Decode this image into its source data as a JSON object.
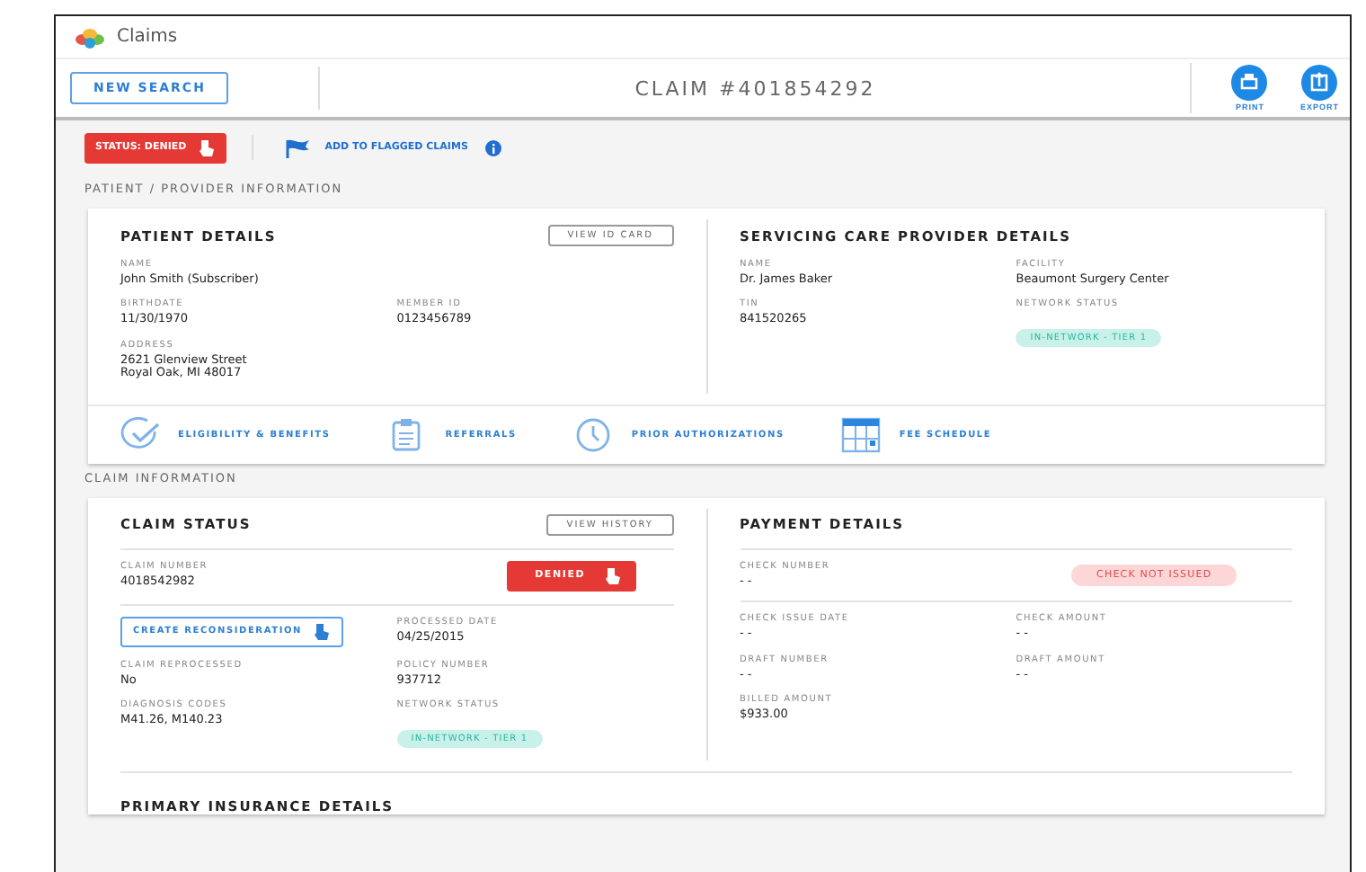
{
  "app": {
    "title": "Claims"
  },
  "toolbar": {
    "new_search": "NEW SEARCH",
    "claim_title": "CLAIM #401854292",
    "actions": [
      {
        "label": "PRINT",
        "kind": "print"
      },
      {
        "label": "EXPORT",
        "kind": "export"
      }
    ]
  },
  "status_row": {
    "status": "STATUS: DENIED",
    "flag_link": "ADD TO FLAGGED CLAIMS"
  },
  "patient_provider": {
    "heading": "PATIENT / PROVIDER INFORMATION",
    "columns": [
      {
        "title": "PATIENT DETAILS",
        "button": "VIEW ID CARD",
        "rows": [
          [
            {
              "kind": "field",
              "label": "NAME",
              "value": "John Smith (Subscriber)"
            }
          ],
          [
            {
              "kind": "field",
              "label": "BIRTHDATE",
              "value": "11/30/1970"
            },
            {
              "kind": "field",
              "label": "MEMBER ID",
              "value": "0123456789"
            }
          ],
          [
            {
              "kind": "field",
              "label": "ADDRESS",
              "value": "2621 Glenview Street\nRoyal Oak, MI 48017"
            }
          ]
        ]
      },
      {
        "title": "SERVICING CARE PROVIDER DETAILS",
        "rows": [
          [
            {
              "kind": "field",
              "label": "NAME",
              "value": "Dr. James Baker"
            },
            {
              "kind": "field",
              "label": "FACILITY",
              "value": "Beaumont Surgery Center"
            }
          ],
          [
            {
              "kind": "field",
              "label": "TIN",
              "value": "841520265"
            },
            {
              "kind": "network_tag",
              "label": "NETWORK STATUS",
              "value": "IN-NETWORK - TIER 1"
            }
          ]
        ]
      }
    ],
    "links": [
      {
        "label": "ELIGIBILITY & BENEFITS",
        "kind": "check"
      },
      {
        "label": "REFERRALS",
        "kind": "clipboard"
      },
      {
        "label": "PRIOR AUTHORIZATIONS",
        "kind": "clock"
      },
      {
        "label": "FEE SCHEDULE",
        "kind": "calendar"
      }
    ]
  },
  "claim_information": {
    "heading": "CLAIM INFORMATION",
    "columns": [
      {
        "title": "CLAIM STATUS",
        "button": "VIEW HISTORY",
        "groups": [
          [
            [
              {
                "kind": "field",
                "label": "CLAIM NUMBER",
                "value": "4018542982"
              },
              {
                "kind": "danger_button",
                "value": "DENIED"
              }
            ]
          ],
          [
            [
              {
                "kind": "outline_button",
                "value": "CREATE RECONSIDERATION"
              },
              {
                "kind": "field",
                "label": "PROCESSED DATE",
                "value": "04/25/2015"
              }
            ],
            [
              {
                "kind": "field",
                "label": "CLAIM REPROCESSED",
                "value": "No"
              },
              {
                "kind": "field",
                "label": "POLICY NUMBER",
                "value": "937712"
              }
            ],
            [
              {
                "kind": "field",
                "label": "DIAGNOSIS CODES",
                "value": "M41.26, M140.23"
              },
              {
                "kind": "network_tag",
                "label": "NETWORK STATUS",
                "value": "IN-NETWORK - TIER 1"
              }
            ]
          ]
        ]
      },
      {
        "title": "PAYMENT DETAILS",
        "groups": [
          [
            [
              {
                "kind": "field",
                "label": "CHECK NUMBER",
                "value": "- -"
              },
              {
                "kind": "alert_pill",
                "value": "CHECK NOT ISSUED"
              }
            ]
          ],
          [
            [
              {
                "kind": "field",
                "label": "CHECK ISSUE DATE",
                "value": "- -"
              },
              {
                "kind": "field",
                "label": "CHECK AMOUNT",
                "value": "- -"
              }
            ],
            [
              {
                "kind": "field",
                "label": "DRAFT NUMBER",
                "value": "- -"
              },
              {
                "kind": "field",
                "label": "DRAFT AMOUNT",
                "value": "- -"
              }
            ],
            [
              {
                "kind": "field",
                "label": "BILLED AMOUNT",
                "value": "$933.00"
              }
            ]
          ]
        ]
      }
    ],
    "next_title": "PRIMARY INSURANCE DETAILS"
  }
}
